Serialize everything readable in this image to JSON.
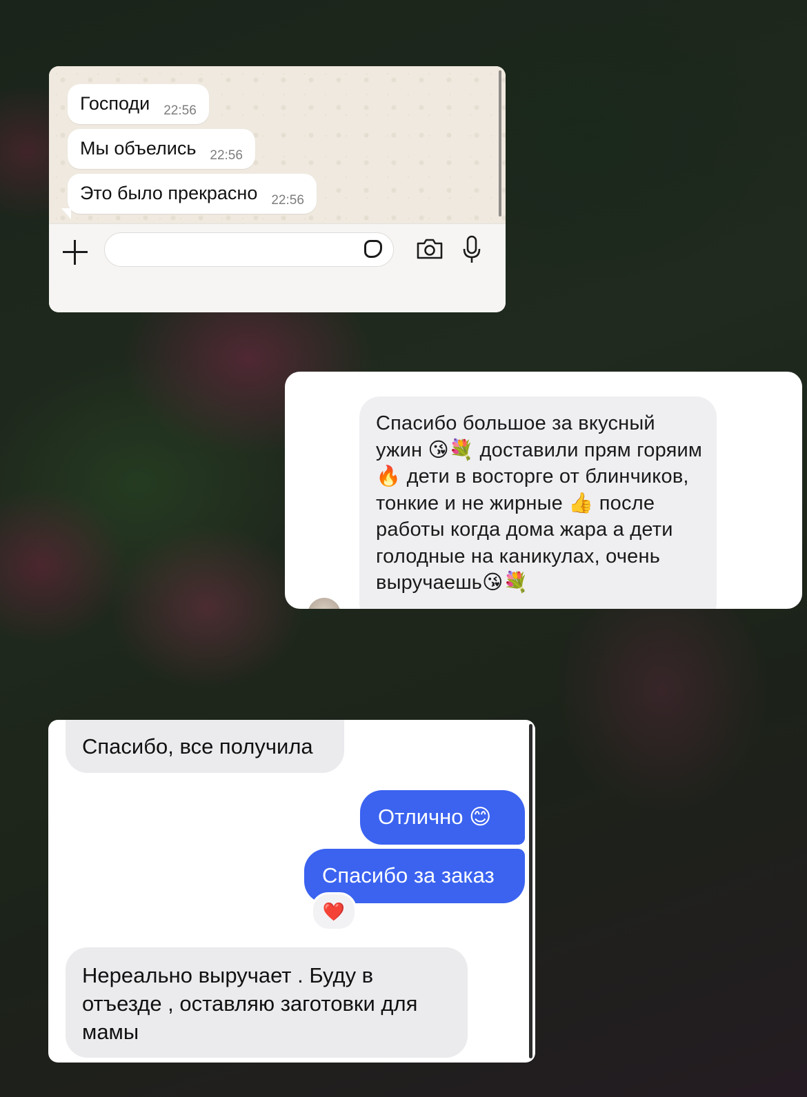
{
  "whatsapp": {
    "messages": [
      {
        "text": "Господи",
        "time": "22:56"
      },
      {
        "text": "Мы объелись",
        "time": "22:56"
      },
      {
        "text": "Это было прекрасно",
        "time": "22:56"
      }
    ],
    "input_placeholder": ""
  },
  "instagram": {
    "message": "Спасибо большое за вкусный ужин 😘💐 доставили прям горяим🔥 дети в восторге от блинчиков, тонкие и не жирные 👍 после работы когда дома жара а дети голодные на каникулах, очень выручаешь😘💐"
  },
  "vk": {
    "messages": [
      {
        "direction": "in",
        "text": "Спасибо, все получила"
      },
      {
        "direction": "out",
        "text": "Отлично 😊"
      },
      {
        "direction": "out",
        "text": "Спасибо за заказ"
      },
      {
        "direction": "in",
        "text": "Нереально выручает . Буду в отъезде , оставляю заготовки для мамы"
      }
    ],
    "reaction": "❤️"
  },
  "colors": {
    "vk_outgoing": "#3b63f0",
    "vk_incoming": "#ebebee",
    "ig_bubble": "#efeff2",
    "wa_wallpaper": "#efe9df"
  }
}
